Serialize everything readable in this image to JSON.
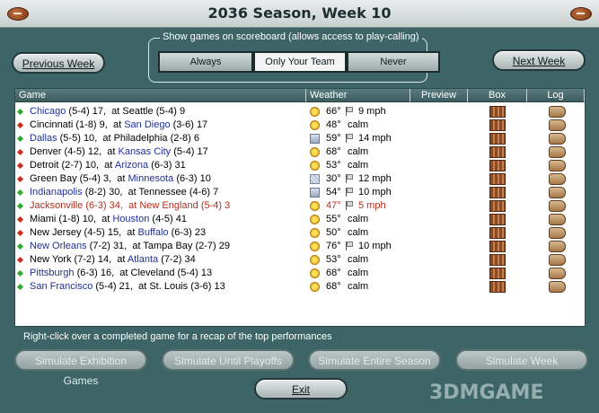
{
  "window": {
    "title": "2036 Season, Week 10"
  },
  "nav": {
    "prev_label": "Previous Week",
    "next_label": "Next Week"
  },
  "scoreboard_filter": {
    "legend": "Show games on scoreboard (allows access to play-calling)",
    "options": [
      "Always",
      "Only Your Team",
      "Never"
    ],
    "selected": "Only Your Team"
  },
  "table": {
    "headers": [
      "Game",
      "Weather",
      "Preview",
      "Box",
      "Log"
    ],
    "games": [
      {
        "bullet": "#2faa2f",
        "away": "Chicago",
        "away_rec": "(5-4)",
        "away_score": "17",
        "home": "Seattle",
        "home_rec": "(5-4)",
        "home_score": "9",
        "away_blue": true,
        "home_blue": false,
        "icon": "sun",
        "temp": "66°",
        "wind_flag": true,
        "wind": "9 mph",
        "hl": false
      },
      {
        "bullet": "#cc2a1a",
        "away": "Cincinnati",
        "away_rec": "(1-8)",
        "away_score": "9",
        "home": "San Diego",
        "home_rec": "(3-6)",
        "home_score": "17",
        "away_blue": false,
        "home_blue": true,
        "icon": "sun",
        "temp": "48°",
        "wind_flag": false,
        "wind": "calm",
        "hl": false
      },
      {
        "bullet": "#2faa2f",
        "away": "Dallas",
        "away_rec": "(5-5)",
        "away_score": "10",
        "home": "Philadelphia",
        "home_rec": "(2-8)",
        "home_score": "6",
        "away_blue": true,
        "home_blue": false,
        "icon": "cloud",
        "temp": "59°",
        "wind_flag": true,
        "wind": "14 mph",
        "hl": false
      },
      {
        "bullet": "#cc2a1a",
        "away": "Denver",
        "away_rec": "(4-5)",
        "away_score": "12",
        "home": "Kansas City",
        "home_rec": "(5-4)",
        "home_score": "17",
        "away_blue": false,
        "home_blue": true,
        "icon": "sun",
        "temp": "68°",
        "wind_flag": false,
        "wind": "calm",
        "hl": false
      },
      {
        "bullet": "#cc2a1a",
        "away": "Detroit",
        "away_rec": "(2-7)",
        "away_score": "10",
        "home": "Arizona",
        "home_rec": "(6-3)",
        "home_score": "31",
        "away_blue": false,
        "home_blue": true,
        "icon": "sun",
        "temp": "53°",
        "wind_flag": false,
        "wind": "calm",
        "hl": false
      },
      {
        "bullet": "#cc2a1a",
        "away": "Green Bay",
        "away_rec": "(5-4)",
        "away_score": "3",
        "home": "Minnesota",
        "home_rec": "(6-3)",
        "home_score": "10",
        "away_blue": false,
        "home_blue": true,
        "icon": "snow",
        "temp": "30°",
        "wind_flag": true,
        "wind": "12 mph",
        "hl": false
      },
      {
        "bullet": "#2faa2f",
        "away": "Indianapolis",
        "away_rec": "(8-2)",
        "away_score": "30",
        "home": "Tennessee",
        "home_rec": "(4-6)",
        "home_score": "7",
        "away_blue": true,
        "home_blue": false,
        "icon": "cloud",
        "temp": "54°",
        "wind_flag": true,
        "wind": "10 mph",
        "hl": false
      },
      {
        "bullet": "#2faa2f",
        "away": "Jacksonville",
        "away_rec": "(6-3)",
        "away_score": "34",
        "home": "New England",
        "home_rec": "(5-4)",
        "home_score": "3",
        "away_blue": true,
        "home_blue": true,
        "icon": "sun",
        "temp": "47°",
        "wind_flag": true,
        "wind": "5 mph",
        "hl": true
      },
      {
        "bullet": "#cc2a1a",
        "away": "Miami",
        "away_rec": "(1-8)",
        "away_score": "10",
        "home": "Houston",
        "home_rec": "(4-5)",
        "home_score": "41",
        "away_blue": false,
        "home_blue": true,
        "icon": "sun",
        "temp": "55°",
        "wind_flag": false,
        "wind": "calm",
        "hl": false
      },
      {
        "bullet": "#cc2a1a",
        "away": "New Jersey",
        "away_rec": "(4-5)",
        "away_score": "15",
        "home": "Buffalo",
        "home_rec": "(6-3)",
        "home_score": "23",
        "away_blue": false,
        "home_blue": true,
        "icon": "sun",
        "temp": "50°",
        "wind_flag": false,
        "wind": "calm",
        "hl": false
      },
      {
        "bullet": "#2faa2f",
        "away": "New Orleans",
        "away_rec": "(7-2)",
        "away_score": "31",
        "home": "Tampa Bay",
        "home_rec": "(2-7)",
        "home_score": "29",
        "away_blue": true,
        "home_blue": false,
        "icon": "sun",
        "temp": "76°",
        "wind_flag": true,
        "wind": "10 mph",
        "hl": false
      },
      {
        "bullet": "#cc2a1a",
        "away": "New York",
        "away_rec": "(7-2)",
        "away_score": "14",
        "home": "Atlanta",
        "home_rec": "(7-2)",
        "home_score": "34",
        "away_blue": false,
        "home_blue": true,
        "icon": "sun",
        "temp": "53°",
        "wind_flag": false,
        "wind": "calm",
        "hl": false
      },
      {
        "bullet": "#2faa2f",
        "away": "Pittsburgh",
        "away_rec": "(6-3)",
        "away_score": "16",
        "home": "Cleveland",
        "home_rec": "(5-4)",
        "home_score": "13",
        "away_blue": true,
        "home_blue": false,
        "icon": "sun",
        "temp": "68°",
        "wind_flag": false,
        "wind": "calm",
        "hl": false
      },
      {
        "bullet": "#2faa2f",
        "away": "San Francisco",
        "away_rec": "(5-4)",
        "away_score": "21",
        "home": "St. Louis",
        "home_rec": "(3-6)",
        "home_score": "13",
        "away_blue": true,
        "home_blue": false,
        "icon": "sun",
        "temp": "68°",
        "wind_flag": false,
        "wind": "calm",
        "hl": false
      }
    ]
  },
  "hint": "Right-click over a completed game for a recap of the top performances",
  "sim_buttons": [
    "Simulate Exhibition Games",
    "Simulate Until Playoffs",
    "Simulate Entire Season",
    "Simulate Week"
  ],
  "exit_label": "Exit",
  "watermark": "3DMGAME",
  "colors": {
    "background": "#3d6466",
    "win_bullet": "#2faa2f",
    "loss_bullet": "#cc2a1a",
    "team_link": "#1f2f9a",
    "highlight": "#b03020"
  }
}
